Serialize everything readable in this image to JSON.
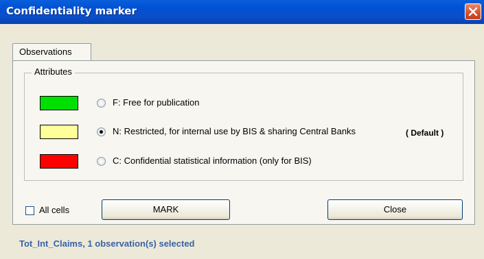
{
  "window": {
    "title": "Confidentiality marker"
  },
  "tabs": [
    {
      "label": "Observations"
    }
  ],
  "attributes": {
    "group_label": "Attributes",
    "options": [
      {
        "color": "#00e000",
        "label": "F:  Free for publication",
        "selected": false
      },
      {
        "color": "#ffff99",
        "label": "N:  Restricted, for internal use by BIS & sharing Central Banks",
        "selected": true,
        "tag": "( Default )"
      },
      {
        "color": "#ff0000",
        "label": "C:  Confidential statistical information (only for BIS)",
        "selected": false
      }
    ]
  },
  "all_cells": {
    "label": "All cells",
    "checked": false
  },
  "buttons": {
    "mark": "MARK",
    "close": "Close"
  },
  "status": "Tot_Int_Claims, 1 observation(s) selected"
}
